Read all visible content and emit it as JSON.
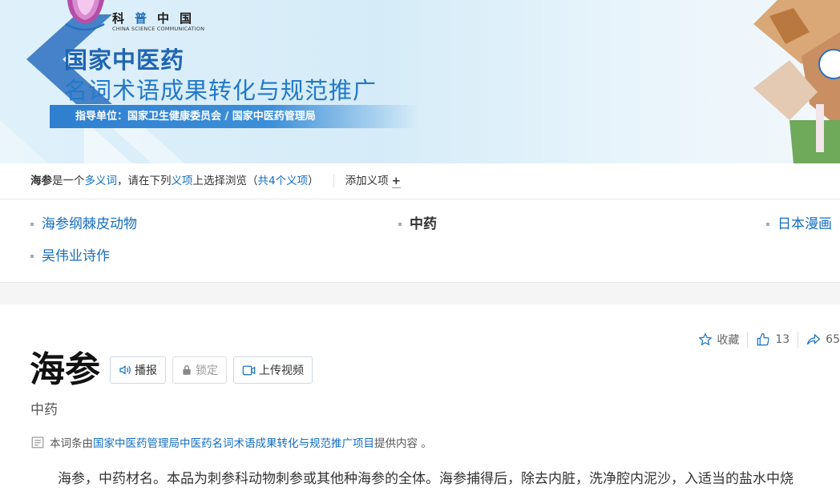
{
  "banner": {
    "logo_cn": [
      "科",
      "普",
      "中",
      "国"
    ],
    "logo_en": "CHINA SCIENCE COMMUNICATION",
    "title1": "国家中医药",
    "title2": "名词术语成果转化与规范推广",
    "guide": "指导单位：国家卫生健康委员会 / 国家中医药管理局"
  },
  "polysemy": {
    "term": "海参",
    "text1": "是一个",
    "link1": "多义词",
    "text2": "，请在下列",
    "link2": "义项",
    "text3": "上选择浏览（",
    "link3": "共4个义项",
    "text4": "）",
    "add_label": "添加义项",
    "add_plus": "+"
  },
  "senses": [
    {
      "label": "海参纲棘皮动物",
      "current": false
    },
    {
      "label": "中药",
      "current": true
    },
    {
      "label": "日本漫画",
      "current": false
    },
    {
      "label": "吴伟业诗作",
      "current": false
    }
  ],
  "tools": {
    "collect": "收藏",
    "like_count": "13",
    "share_count": "65"
  },
  "entry": {
    "title": "海参",
    "btn_read": "播报",
    "btn_lock": "锁定",
    "btn_video": "上传视频",
    "subtitle": "中药",
    "source_pre": "本词条由",
    "source_link": "国家中医药管理局中医药名词术语成果转化与规范推广项目",
    "source_post": " 提供内容 。",
    "paragraph": "海参，中药材名。本品为刺参科动物刺参或其他种海参的全体。海参捕得后，除去内脏，洗净腔内泥沙，入适当的盐水中烧"
  },
  "colors": {
    "link": "#136ec2",
    "banner_blue": "#1f64b4"
  }
}
